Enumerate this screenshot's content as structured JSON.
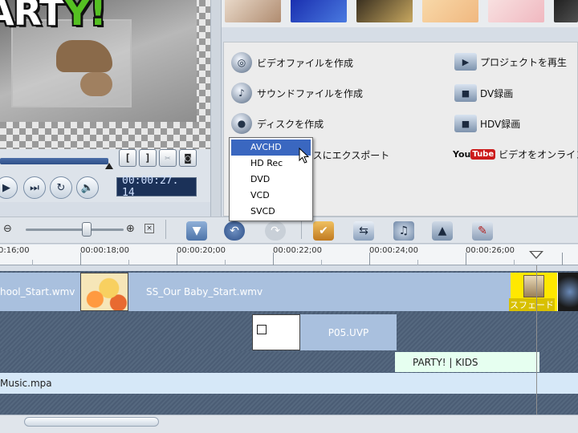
{
  "preview": {
    "title_text_part1": "ART",
    "title_text_part2": "Y!",
    "timecode": "00:00:27. 14"
  },
  "controls": {
    "mark_in": "[",
    "mark_out": "]",
    "cut_icon": "scissors-icon",
    "snapshot_icon": "snapshot-icon"
  },
  "actions": {
    "left": [
      {
        "label": "ビデオファイルを作成",
        "icon": "film-reel-icon"
      },
      {
        "label": "サウンドファイルを作成",
        "icon": "sound-icon"
      },
      {
        "label": "ディスクを作成",
        "icon": "disc-icon"
      },
      {
        "label": "イスにエクスポート",
        "icon": "export-icon"
      }
    ],
    "right": [
      {
        "label": "プロジェクトを再生",
        "icon": "play-project-icon"
      },
      {
        "label": "DV録画",
        "icon": "dv-camera-icon"
      },
      {
        "label": "HDV録画",
        "icon": "hdv-camera-icon"
      },
      {
        "label": "ビデオをオンラインア",
        "icon": "youtube-icon"
      }
    ],
    "youtube_you": "You",
    "youtube_tube": "Tube"
  },
  "dropdown": {
    "items": [
      "AVCHD",
      "HD Rec",
      "DVD",
      "VCD",
      "SVCD"
    ],
    "selected": "AVCHD"
  },
  "ruler": {
    "labels": [
      "0:16;00",
      "00:00:18;00",
      "00:00:20;00",
      "00:00:22;00",
      "00:00:24;00",
      "00:00:26;00"
    ]
  },
  "timeline": {
    "video_clip_1": "hool_Start.wmv",
    "video_clip_2": "SS_Our Baby_Start.wmv",
    "transition_label": "スフェード",
    "overlay_clip": "P05.UVP",
    "title_clip": "PARTY! | KIDS",
    "music_clip": "Music.mpa"
  },
  "colors": {
    "accent": "#3a67c0",
    "video_track": "#a9c0de",
    "title_track": "#e6fff0",
    "music_track": "#d6e8f8",
    "transition": "#ffe800"
  }
}
